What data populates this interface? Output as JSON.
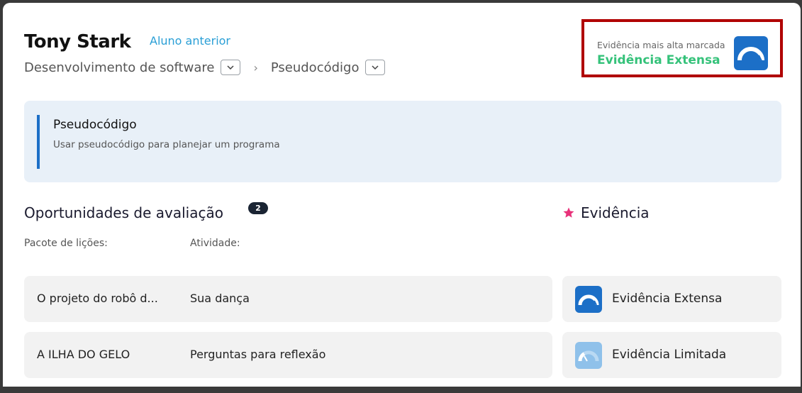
{
  "header": {
    "student_name": "Tony Stark",
    "prev_student_link": "Aluno anterior"
  },
  "breadcrumb": {
    "course": "Desenvolvimento de software",
    "topic": "Pseudocódigo",
    "separator": "›"
  },
  "highest_evidence": {
    "label": "Evidência mais alta marcada",
    "value": "Evidência Extensa",
    "icon": "gauge-full-icon",
    "value_color": "#35c27a"
  },
  "skill": {
    "title": "Pseudocódigo",
    "description": "Usar pseudocódigo para planejar um programa"
  },
  "opportunities": {
    "title": "Oportunidades de avaliação",
    "count": "2",
    "col_package": "Pacote de lições:",
    "col_activity": "Atividade:",
    "rows": [
      {
        "package": "O projeto do robô de dança",
        "package_display": "O projeto do robô d...",
        "activity": "Sua dança"
      },
      {
        "package": "A ILHA DO GELO",
        "package_display": "A ILHA DO GELO",
        "activity": "Perguntas para reflexão"
      }
    ]
  },
  "evidence": {
    "title": "Evidência",
    "star_color": "#e8317a",
    "rows": [
      {
        "label": "Evidência Extensa",
        "icon": "gauge-full-icon"
      },
      {
        "label": "Evidência Limitada",
        "icon": "gauge-low-icon"
      }
    ]
  },
  "colors": {
    "link": "#2a9fd6",
    "accent_blue": "#1c6fc7",
    "info_bg": "#e8f0f8",
    "highlight_border": "#b00000"
  }
}
